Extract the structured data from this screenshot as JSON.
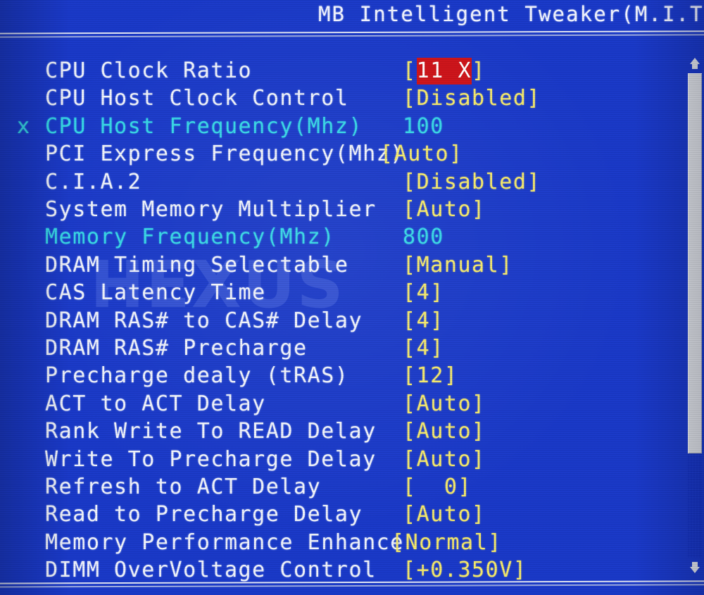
{
  "screen": {
    "title": "MB Intelligent Tweaker(M.I.T",
    "watermark": "HEXUS",
    "background_color": "#1838c8",
    "label_color": "#f0f3fb",
    "value_color": "#f5e96a",
    "dim_color": "#35d8e6",
    "highlight_bg_color": "#cc1016",
    "highlight_fg_color": "#ffffff"
  },
  "scrollbar": {
    "up_arrow": "scroll-up-arrow",
    "down_arrow": "scroll-down-arrow",
    "thumb": "scroll-thumb",
    "track": "scroll-track"
  },
  "options": [
    {
      "marker": "",
      "label": "CPU Clock Ratio",
      "value": "[11 X]",
      "value_open": "[",
      "value_text": "11 X",
      "value_close": "]",
      "selected": true,
      "dim": false,
      "numeric": false,
      "tight": 0
    },
    {
      "marker": "",
      "label": "CPU Host Clock Control",
      "value": "[Disabled]",
      "selected": false,
      "dim": false,
      "numeric": false,
      "tight": 0
    },
    {
      "marker": "x",
      "label": "CPU Host Frequency(Mhz)",
      "value": "100",
      "selected": false,
      "dim": true,
      "numeric": true,
      "tight": 0
    },
    {
      "marker": "",
      "label": "PCI Express Frequency(Mhz)",
      "value": "[Auto]",
      "selected": false,
      "dim": false,
      "numeric": false,
      "tight": 1
    },
    {
      "marker": "",
      "label": "C.I.A.2",
      "value": "[Disabled]",
      "selected": false,
      "dim": false,
      "numeric": false,
      "tight": 0
    },
    {
      "marker": "",
      "label": "System Memory Multiplier",
      "value": "[Auto]",
      "selected": false,
      "dim": false,
      "numeric": false,
      "tight": 0
    },
    {
      "marker": "",
      "label": "Memory Frequency(Mhz)",
      "value": "800",
      "selected": false,
      "dim": true,
      "numeric": true,
      "tight": 0
    },
    {
      "marker": "",
      "label": "DRAM Timing Selectable",
      "value": "[Manual]",
      "selected": false,
      "dim": false,
      "numeric": false,
      "tight": 0
    },
    {
      "marker": "",
      "label": "CAS Latency Time",
      "value": "[4]",
      "selected": false,
      "dim": false,
      "numeric": false,
      "tight": 0
    },
    {
      "marker": "",
      "label": "DRAM RAS# to CAS# Delay",
      "value": "[4]",
      "selected": false,
      "dim": false,
      "numeric": false,
      "tight": 0
    },
    {
      "marker": "",
      "label": "DRAM RAS# Precharge",
      "value": "[4]",
      "selected": false,
      "dim": false,
      "numeric": false,
      "tight": 0
    },
    {
      "marker": "",
      "label": "Precharge dealy (tRAS)",
      "value": "[12]",
      "selected": false,
      "dim": false,
      "numeric": false,
      "tight": 0
    },
    {
      "marker": "",
      "label": "ACT to ACT Delay",
      "value": "[Auto]",
      "selected": false,
      "dim": false,
      "numeric": false,
      "tight": 0
    },
    {
      "marker": "",
      "label": "Rank Write To READ Delay",
      "value": "[Auto]",
      "selected": false,
      "dim": false,
      "numeric": false,
      "tight": 0
    },
    {
      "marker": "",
      "label": "Write To Precharge Delay",
      "value": "[Auto]",
      "selected": false,
      "dim": false,
      "numeric": false,
      "tight": 0
    },
    {
      "marker": "",
      "label": "Refresh to ACT Delay",
      "value": "[  0]",
      "selected": false,
      "dim": false,
      "numeric": false,
      "tight": 0
    },
    {
      "marker": "",
      "label": "Read to Precharge Delay",
      "value": "[Auto]",
      "selected": false,
      "dim": false,
      "numeric": false,
      "tight": 0
    },
    {
      "marker": "",
      "label": "Memory Performance Enhance",
      "value": "[Normal]",
      "selected": false,
      "dim": false,
      "numeric": false,
      "tight": 2
    },
    {
      "marker": "",
      "label": "DIMM OverVoltage Control",
      "value": "[+0.350V]",
      "selected": false,
      "dim": false,
      "numeric": false,
      "tight": 0
    }
  ]
}
